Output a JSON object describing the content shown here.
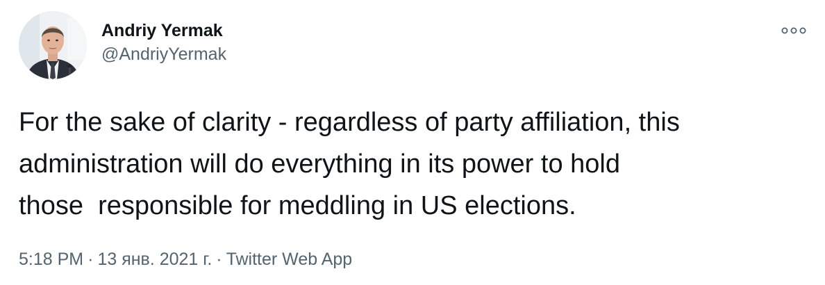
{
  "tweet": {
    "display_name": "Andriy Yermak",
    "handle": "@AndriyYermak",
    "text": "For the sake of clarity - regardless of party affiliation, this\nadministration will do everything in its power to hold\nthose  responsible for meddling in US elections.",
    "time": "5:18 PM",
    "date": "13 янв. 2021 г.",
    "source": "Twitter Web App",
    "separator": "·"
  },
  "icons": {
    "more": "more-options-icon",
    "avatar": "profile-photo"
  },
  "colors": {
    "text": "#0f1419",
    "secondary": "#536471",
    "background": "#ffffff"
  }
}
